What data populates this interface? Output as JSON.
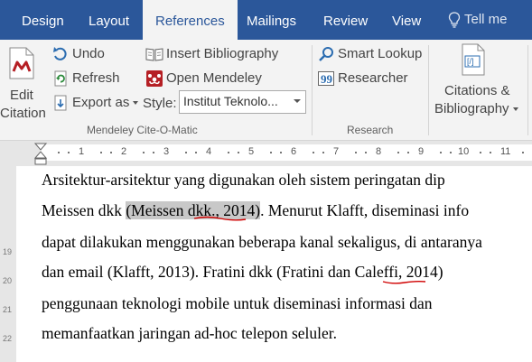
{
  "tabs": [
    "Design",
    "Layout",
    "References",
    "Mailings",
    "Review",
    "View"
  ],
  "tell_me": "Tell me",
  "mendeley": {
    "edit_citation": [
      "Edit",
      "Citation"
    ],
    "undo": "Undo",
    "refresh": "Refresh",
    "export_as": "Export as",
    "insert_bibliography": "Insert Bibliography",
    "open_mendeley": "Open Mendeley",
    "style_label": "Style:",
    "style_value": "Institut Teknolo...",
    "group_label": "Mendeley Cite-O-Matic"
  },
  "research": {
    "smart_lookup": "Smart Lookup",
    "researcher": "Researcher",
    "group_label": "Research"
  },
  "citations": {
    "label": [
      "Citations &",
      "Bibliography"
    ]
  },
  "ruler": {
    "numbers": [
      "1",
      "2",
      "3",
      "4",
      "5",
      "6",
      "7",
      "8",
      "9",
      "10",
      "11"
    ]
  },
  "vertical_ruler": [
    "19",
    "20",
    "21",
    "22"
  ],
  "document": {
    "lines": [
      "Arsitektur-arsitektur yang digunakan oleh sistem peringatan dip",
      [
        "Meissen dkk ",
        "(Meissen dkk., 2014)",
        ". Menurut Klafft, diseminasi info"
      ],
      "dapat dilakukan menggunakan beberapa kanal sekaligus, di antaranya",
      "dan email (Klafft, 2013). Fratini dkk (Fratini dan Caleffi, 2014)",
      "penggunaan teknologi mobile untuk diseminasi informasi dan",
      "memanfaatkan jaringan ad-hoc telepon seluler."
    ]
  },
  "colors": {
    "tab_bar": "#2b579a",
    "ribbon": "#f3f3f3",
    "citation_field": "#c8c8c8",
    "spellcheck": "#d00000"
  }
}
